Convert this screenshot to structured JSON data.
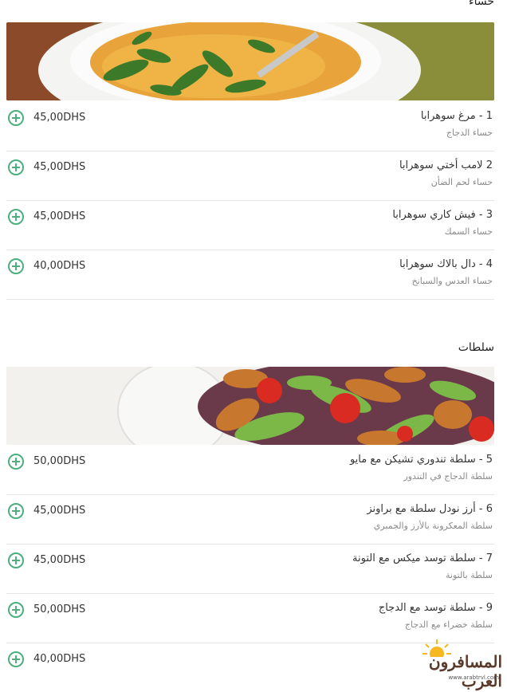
{
  "sections": [
    {
      "title": "حساء",
      "items": [
        {
          "price": "45,00DHS",
          "name": "1 - مرغ سوهرابا",
          "desc": "حساء الدجاج"
        },
        {
          "price": "45,00DHS",
          "name": "2 لامب أختي سوهرابا",
          "desc": "حساء لحم الضأن"
        },
        {
          "price": "45,00DHS",
          "name": "3 - فيش كاري سوهرابا",
          "desc": "حساء السمك"
        },
        {
          "price": "40,00DHS",
          "name": "4 - دال بالاك سوهرابا",
          "desc": "حساء العدس والسبانخ"
        }
      ]
    },
    {
      "title": "سلطات",
      "items": [
        {
          "price": "50,00DHS",
          "name": "5 - سلطة تندوري تشيكن مع مايو",
          "desc": "سلطة الدجاج في التندور"
        },
        {
          "price": "45,00DHS",
          "name": "6 - أرز نودل سلطة مع براونز",
          "desc": "سلطة المعكرونة بالأرز والجمبري"
        },
        {
          "price": "45,00DHS",
          "name": "7 - سلطة توسد ميكس مع التونة",
          "desc": "سلطة بالتونة"
        },
        {
          "price": "50,00DHS",
          "name": "9 - سلطة توسد مع الدجاج",
          "desc": "سلطة خضراء مع الدجاج"
        },
        {
          "price": "40,00DHS",
          "name": "",
          "desc": ""
        }
      ]
    }
  ],
  "watermark": {
    "text": "المسافرون العرب",
    "url": "www.arabtrvl.com"
  },
  "colors": {
    "accent": "#4caf7d",
    "divider": "#e6e6e6"
  }
}
